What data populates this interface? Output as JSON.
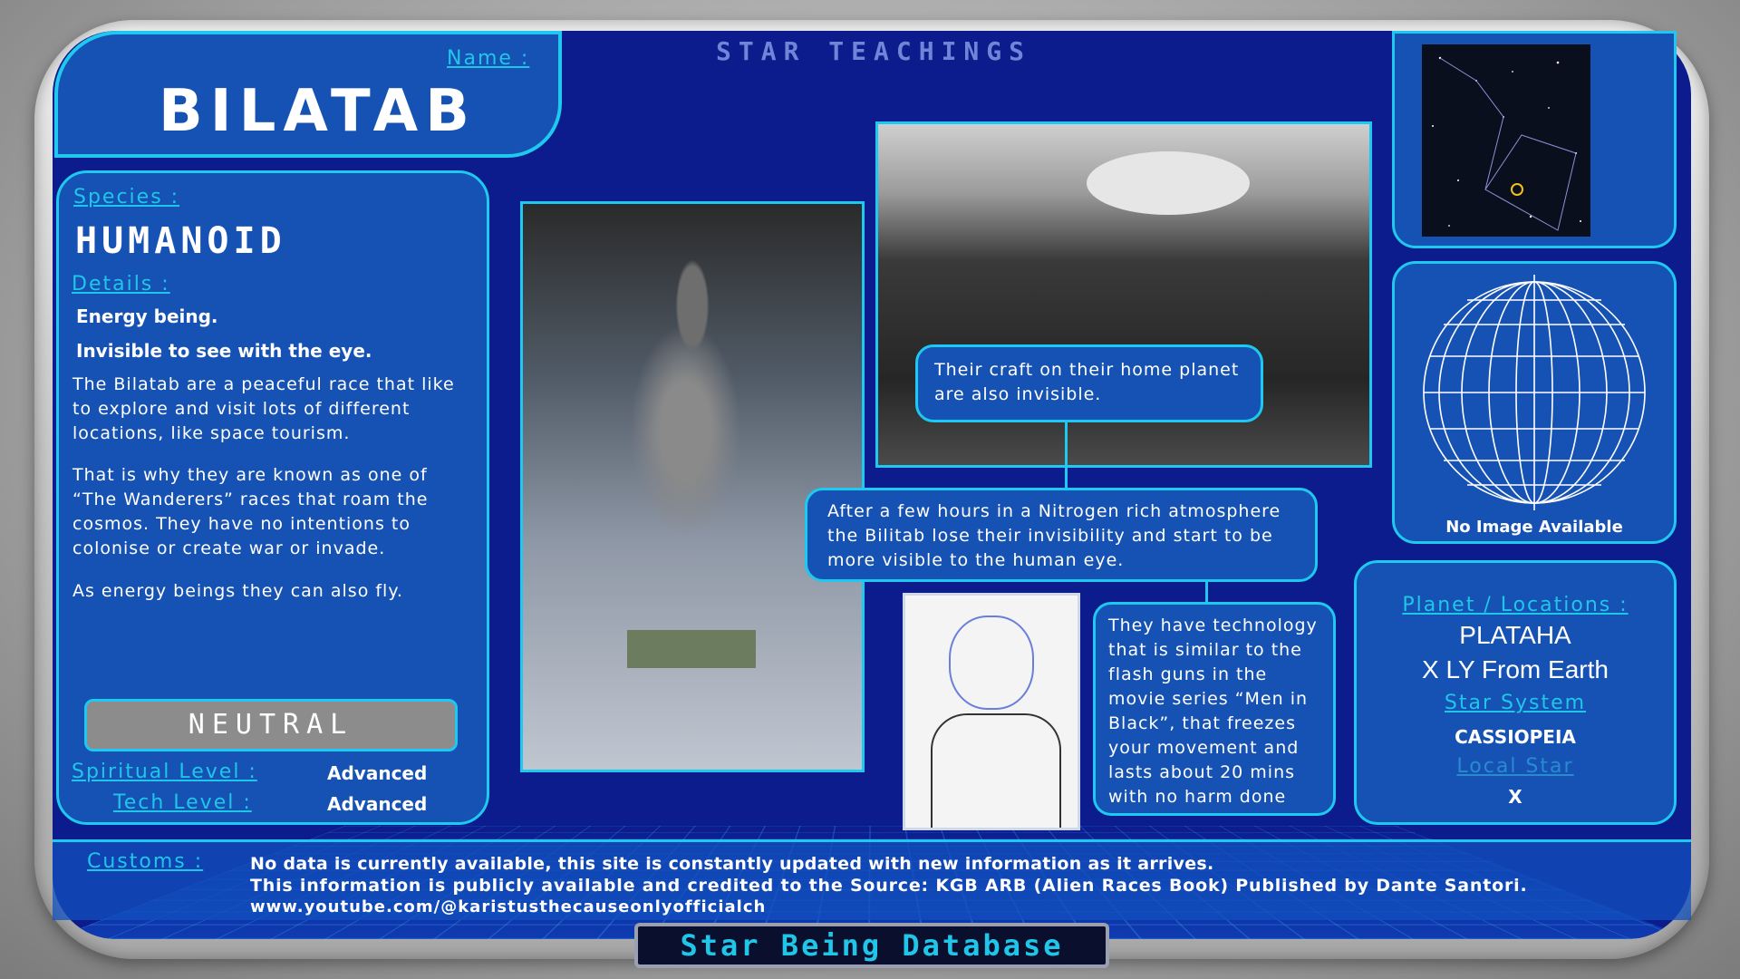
{
  "header": {
    "name_label": "Name :",
    "name": "BILATAB",
    "center_title": "STAR TEACHINGS"
  },
  "species": {
    "label": "Species :",
    "value": "HUMANOID",
    "details_label": "Details :",
    "detail_line_1": "Energy being.",
    "detail_line_2": "Invisible to see with the eye.",
    "para_1": "The Bilatab are a peaceful race that like to explore and visit lots of different locations, like space tourism.",
    "para_2": "That is why they are known as one of “The Wanderers” races that roam the cosmos. They have no intentions to colonise or create war or invade.",
    "para_3": "As energy beings they can also fly.",
    "alignment": "NEUTRAL",
    "spiritual_label": "Spiritual Level :",
    "spiritual_value": "Advanced",
    "tech_label": "Tech Level :",
    "tech_value": "Advanced"
  },
  "callouts": {
    "craft": "Their craft on their home planet are also invisible.",
    "nitrogen": "After a few hours in a Nitrogen rich atmosphere the Bilitab lose their invisibility and start to be more visible to the human eye.",
    "technology": "They have technology that is similar to the flash guns in the movie series “Men in Black”, that freezes your movement and lasts about 20 mins with no harm done"
  },
  "planet_image": {
    "caption": "No Image Available"
  },
  "location": {
    "label": "Planet / Locations :",
    "planet": "PLATAHA",
    "distance": "X LY From Earth",
    "star_system_label": "Star System",
    "star_system": "CASSIOPEIA",
    "local_star_label": "Local Star",
    "local_star": "X"
  },
  "footer": {
    "customs_label": "Customs :",
    "line_1": "No data is currently available, this site is constantly updated with new information as it arrives.",
    "line_2": "This information is publicly available and credited to the Source: KGB ARB (Alien Races Book) Published by Dante Santori.",
    "line_3": "www.youtube.com/@karistusthecauseonlyofficialch",
    "database_title": "Star Being Database"
  },
  "colors": {
    "accent": "#1ec8ef",
    "panel": "#1652b4",
    "background": "#0c1c8c"
  },
  "icons": [
    "constellation-map-icon",
    "wireframe-globe-icon"
  ]
}
